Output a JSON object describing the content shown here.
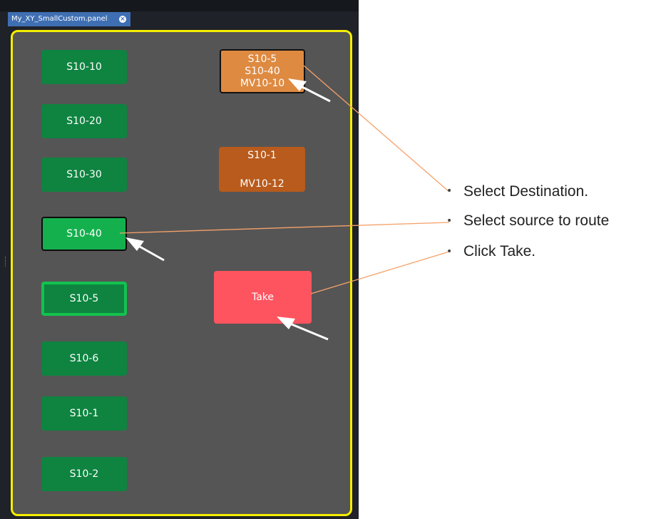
{
  "tab": {
    "label": "My_XY_SmallCustom.panel",
    "close_icon": "close-icon"
  },
  "sources": [
    "S10-10",
    "S10-20",
    "S10-30",
    "S10-40",
    "S10-5",
    "S10-6",
    "S10-1",
    "S10-2"
  ],
  "destinations": [
    {
      "lines": [
        "S10-5",
        "S10-40",
        "MV10-10"
      ]
    },
    {
      "lines": [
        "S10-1",
        "MV10-12"
      ]
    }
  ],
  "take_label": "Take",
  "callouts": [
    "Select Destination.",
    "Select source to route",
    "Click Take."
  ],
  "colors": {
    "panel_border": "#f5ee00",
    "source_button": "#0e8440",
    "source_selected": "#14b04e",
    "destination_selected": "#de8a41",
    "destination": "#b85b1c",
    "take_button": "#fd5460",
    "callout_line": "#f5a26a"
  }
}
